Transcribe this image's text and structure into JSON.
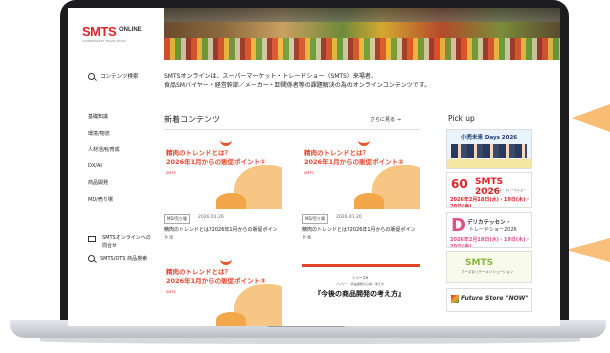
{
  "site": {
    "logo": "SMTS",
    "logo_suffix": "ONLINE",
    "logo_sub": "SUPERMARKET TRADE SHOW"
  },
  "sidebar": {
    "search": "コンテンツ検索",
    "items": [
      "基礎知識",
      "環境/物流",
      "人材活用/育成",
      "DX/AI",
      "商品開発",
      "MD/売り場"
    ],
    "contact_line1": "SMTSオンラインへの",
    "contact_line2": "問合せ",
    "dts_search": "SMTS/DTS 商品検索"
  },
  "intro": {
    "line1": "SMTSオンラインは、スーパーマーケット・トレードショー（SMTS）来場者、",
    "line2": "食品SMバイヤー・経営幹部／メーカー・卸関係者等の課題解決の為のオンラインコンテンツです。"
  },
  "new_contents": {
    "title": "新着コンテンツ",
    "see_more": "さらに見る →",
    "cards": [
      {
        "thumb_title_1": "精肉のトレンドとは？",
        "thumb_title_2": "2026年1月からの販促ポイント①",
        "thumb_logo": "SMTS",
        "tag": "MD/売り場",
        "date": "2026.01.26",
        "title": "精肉のトレンドとは?2026年1月からの販促ポイント①"
      },
      {
        "thumb_title_1": "精肉のトレンドとは？",
        "thumb_title_2": "2026年1月からの販促ポイント②",
        "thumb_logo": "SMTS",
        "tag": "MD/売り場",
        "date": "2026.01.20",
        "title": "精肉のトレンドとは?2026年1月からの販促ポイント②"
      },
      {
        "thumb_title_1": "精肉のトレンドとは？",
        "thumb_title_2": "2026年1月からの販促ポイント③",
        "thumb_logo": "SMTS"
      },
      {
        "series": "シリーズ6",
        "series_sub": "バイヤー・商品開発の心得・考え方",
        "series_big": "『今後の商品開発の考え方』"
      }
    ]
  },
  "pickup": {
    "title": "Pick up",
    "banners": {
      "b1": "小売未来 Days 2026",
      "b2_num": "60",
      "b2_smts": "SMTS 2026",
      "b2_sub": "スーパーマーケット・トレードショー",
      "b2_date": "2026年2月18日(水)・19日(木)・20日(金)",
      "b3_title": "デリカテッセン・",
      "b3_sub": "トレードショー2026",
      "b3_date": "2026年2月18日(水)・19日(木)・20日(金)",
      "b4_title": "SMTS",
      "b4_sub": "フーズ＆リテールソリューション",
      "b5_title": "Future Store \"NOW\""
    }
  },
  "colors": {
    "brand_red": "#e0232b",
    "accent_orange": "#f7b564"
  }
}
